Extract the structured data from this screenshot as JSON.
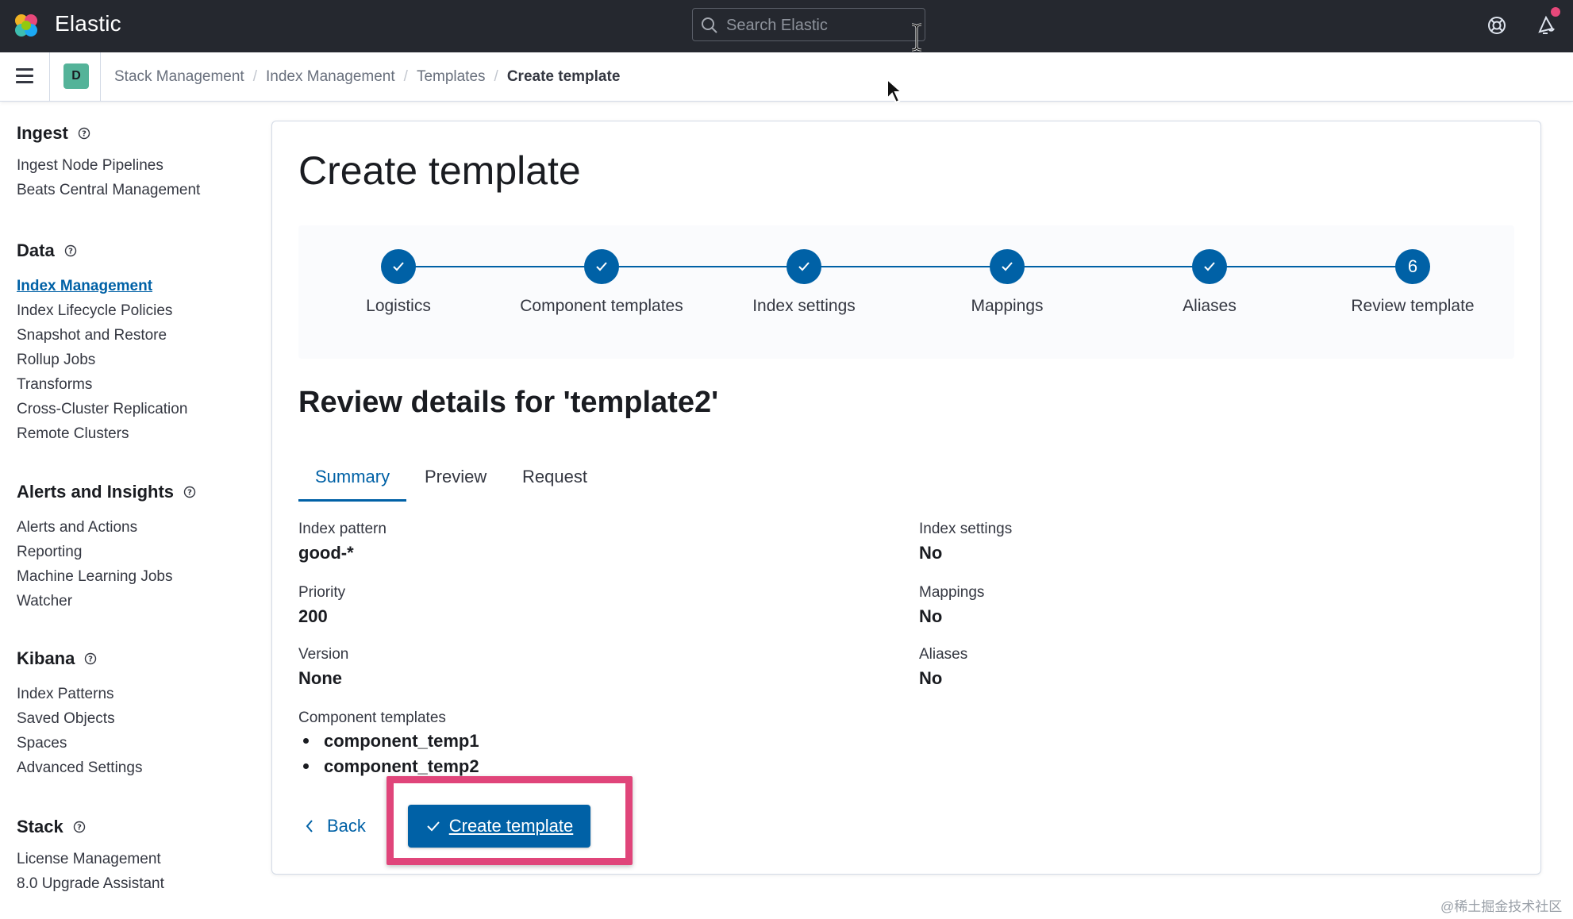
{
  "header": {
    "brand": "Elastic",
    "search_placeholder": "Search Elastic"
  },
  "breadcrumbs": {
    "space_initial": "D",
    "items": [
      "Stack Management",
      "Index Management",
      "Templates",
      "Create template"
    ]
  },
  "sidebar": {
    "groups": [
      {
        "title": "Ingest",
        "items": [
          "Ingest Node Pipelines",
          "Beats Central Management"
        ]
      },
      {
        "title": "Data",
        "items": [
          "Index Management",
          "Index Lifecycle Policies",
          "Snapshot and Restore",
          "Rollup Jobs",
          "Transforms",
          "Cross-Cluster Replication",
          "Remote Clusters"
        ],
        "active_item": "Index Management"
      },
      {
        "title": "Alerts and Insights",
        "items": [
          "Alerts and Actions",
          "Reporting",
          "Machine Learning Jobs",
          "Watcher"
        ]
      },
      {
        "title": "Kibana",
        "items": [
          "Index Patterns",
          "Saved Objects",
          "Spaces",
          "Advanced Settings"
        ]
      },
      {
        "title": "Stack",
        "items": [
          "License Management",
          "8.0 Upgrade Assistant"
        ]
      }
    ]
  },
  "main": {
    "page_title": "Create template",
    "steps": [
      {
        "label": "Logistics",
        "status": "complete"
      },
      {
        "label": "Component templates",
        "status": "complete"
      },
      {
        "label": "Index settings",
        "status": "complete"
      },
      {
        "label": "Mappings",
        "status": "complete"
      },
      {
        "label": "Aliases",
        "status": "complete"
      },
      {
        "label": "Review template",
        "status": "current",
        "number": "6"
      }
    ],
    "review_title": "Review details for 'template2'",
    "tabs": [
      "Summary",
      "Preview",
      "Request"
    ],
    "active_tab": "Summary",
    "summary": {
      "index_pattern_label": "Index pattern",
      "index_pattern_value": "good-*",
      "priority_label": "Priority",
      "priority_value": "200",
      "version_label": "Version",
      "version_value": "None",
      "component_templates_label": "Component templates",
      "component_templates": [
        "component_temp1",
        "component_temp2"
      ],
      "index_settings_label": "Index settings",
      "index_settings_value": "No",
      "mappings_label": "Mappings",
      "mappings_value": "No",
      "aliases_label": "Aliases",
      "aliases_value": "No"
    },
    "back_label": "Back",
    "create_label": "Create template"
  },
  "watermark": "@稀土掘金技术社区",
  "colors": {
    "header_bg": "#25282f",
    "primary": "#0061a6",
    "highlight": "#e0457a"
  }
}
